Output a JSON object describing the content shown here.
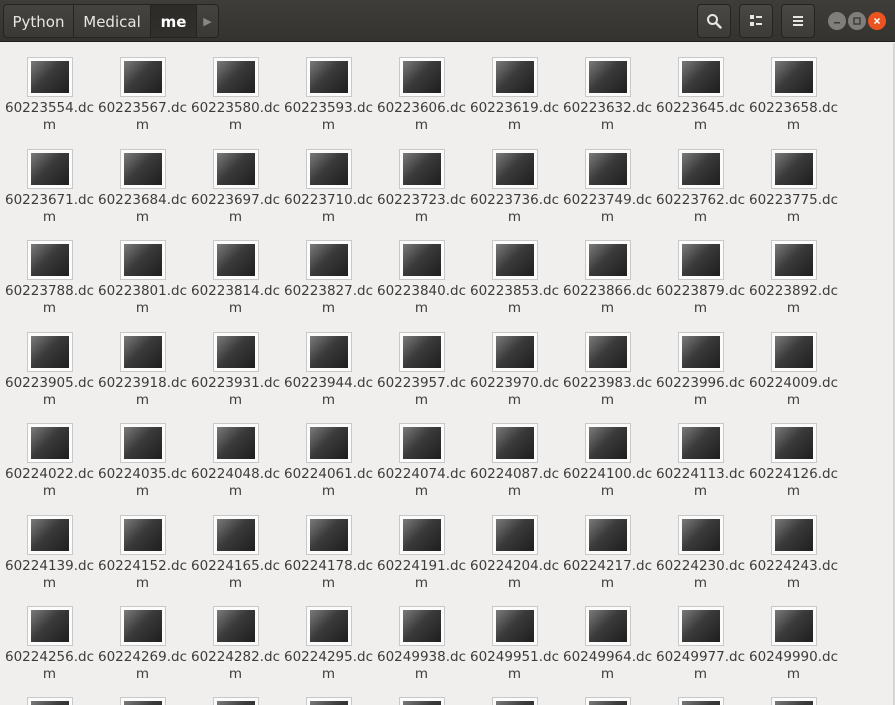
{
  "breadcrumb": [
    "Python",
    "Medical",
    "me"
  ],
  "icons": {
    "search": "search-icon",
    "view": "view-options-icon",
    "menu": "hamburger-menu-icon",
    "next": "chevron-right-icon",
    "minimize": "minimize-icon",
    "maximize": "maximize-icon",
    "close": "close-icon",
    "file": "dicom-image-thumbnail-icon"
  },
  "colors": {
    "close_button": "#e95420",
    "headerbar": "#3c3b37",
    "background": "#f0efed"
  },
  "files": [
    "60223554.dcm",
    "60223567.dcm",
    "60223580.dcm",
    "60223593.dcm",
    "60223606.dcm",
    "60223619.dcm",
    "60223632.dcm",
    "60223645.dcm",
    "60223658.dcm",
    "60223671.dcm",
    "60223684.dcm",
    "60223697.dcm",
    "60223710.dcm",
    "60223723.dcm",
    "60223736.dcm",
    "60223749.dcm",
    "60223762.dcm",
    "60223775.dcm",
    "60223788.dcm",
    "60223801.dcm",
    "60223814.dcm",
    "60223827.dcm",
    "60223840.dcm",
    "60223853.dcm",
    "60223866.dcm",
    "60223879.dcm",
    "60223892.dcm",
    "60223905.dcm",
    "60223918.dcm",
    "60223931.dcm",
    "60223944.dcm",
    "60223957.dcm",
    "60223970.dcm",
    "60223983.dcm",
    "60223996.dcm",
    "60224009.dcm",
    "60224022.dcm",
    "60224035.dcm",
    "60224048.dcm",
    "60224061.dcm",
    "60224074.dcm",
    "60224087.dcm",
    "60224100.dcm",
    "60224113.dcm",
    "60224126.dcm",
    "60224139.dcm",
    "60224152.dcm",
    "60224165.dcm",
    "60224178.dcm",
    "60224191.dcm",
    "60224204.dcm",
    "60224217.dcm",
    "60224230.dcm",
    "60224243.dcm",
    "60224256.dcm",
    "60224269.dcm",
    "60224282.dcm",
    "60224295.dcm",
    "60249938.dcm",
    "60249951.dcm",
    "60249964.dcm",
    "60249977.dcm",
    "60249990.dcm"
  ]
}
